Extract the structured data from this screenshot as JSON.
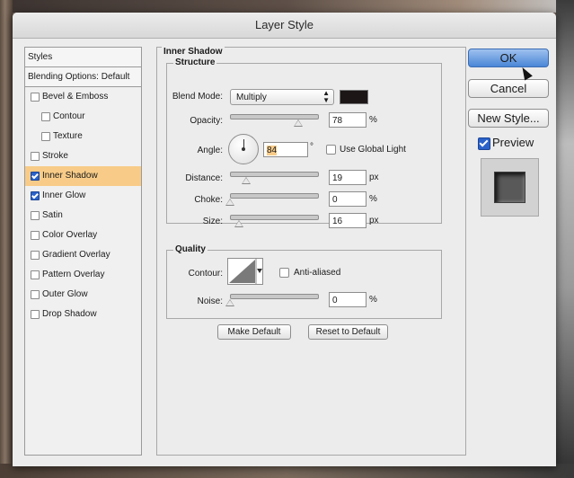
{
  "window": {
    "title": "Layer Style"
  },
  "styles_panel": {
    "header": "Styles",
    "blending_options": "Blending Options: Default",
    "items": [
      {
        "label": "Bevel & Emboss",
        "checked": false,
        "selected": false,
        "indent": false
      },
      {
        "label": "Contour",
        "checked": false,
        "selected": false,
        "indent": true
      },
      {
        "label": "Texture",
        "checked": false,
        "selected": false,
        "indent": true
      },
      {
        "label": "Stroke",
        "checked": false,
        "selected": false,
        "indent": false
      },
      {
        "label": "Inner Shadow",
        "checked": true,
        "selected": true,
        "indent": false
      },
      {
        "label": "Inner Glow",
        "checked": true,
        "selected": false,
        "indent": false
      },
      {
        "label": "Satin",
        "checked": false,
        "selected": false,
        "indent": false
      },
      {
        "label": "Color Overlay",
        "checked": false,
        "selected": false,
        "indent": false
      },
      {
        "label": "Gradient Overlay",
        "checked": false,
        "selected": false,
        "indent": false
      },
      {
        "label": "Pattern Overlay",
        "checked": false,
        "selected": false,
        "indent": false
      },
      {
        "label": "Outer Glow",
        "checked": false,
        "selected": false,
        "indent": false
      },
      {
        "label": "Drop Shadow",
        "checked": false,
        "selected": false,
        "indent": false
      }
    ]
  },
  "inner_shadow": {
    "title": "Inner Shadow",
    "structure": {
      "title": "Structure",
      "blend_mode": {
        "label": "Blend Mode:",
        "value": "Multiply",
        "color": "#1c1617"
      },
      "opacity": {
        "label": "Opacity:",
        "value": "78",
        "unit": "%",
        "level": 0.78
      },
      "angle": {
        "label": "Angle:",
        "value": "84",
        "unit": "°",
        "use_global_light_label": "Use Global Light",
        "use_global_light": false
      },
      "distance": {
        "label": "Distance:",
        "value": "19",
        "unit": "px",
        "level": 0.19
      },
      "choke": {
        "label": "Choke:",
        "value": "0",
        "unit": "%",
        "level": 0.0
      },
      "size": {
        "label": "Size:",
        "value": "16",
        "unit": "px",
        "level": 0.1
      }
    },
    "quality": {
      "title": "Quality",
      "contour_label": "Contour:",
      "anti_aliased_label": "Anti-aliased",
      "anti_aliased": false,
      "noise": {
        "label": "Noise:",
        "value": "0",
        "unit": "%",
        "level": 0.0
      }
    },
    "make_default": "Make Default",
    "reset_to_default": "Reset to Default"
  },
  "actions": {
    "ok": "OK",
    "cancel": "Cancel",
    "new_style": "New Style...",
    "preview_label": "Preview",
    "preview_checked": true
  },
  "colors": {
    "selected_row": "#f8cc88",
    "ok_button": "#5b93dc",
    "checkbox_checked": "#2a62c9"
  }
}
